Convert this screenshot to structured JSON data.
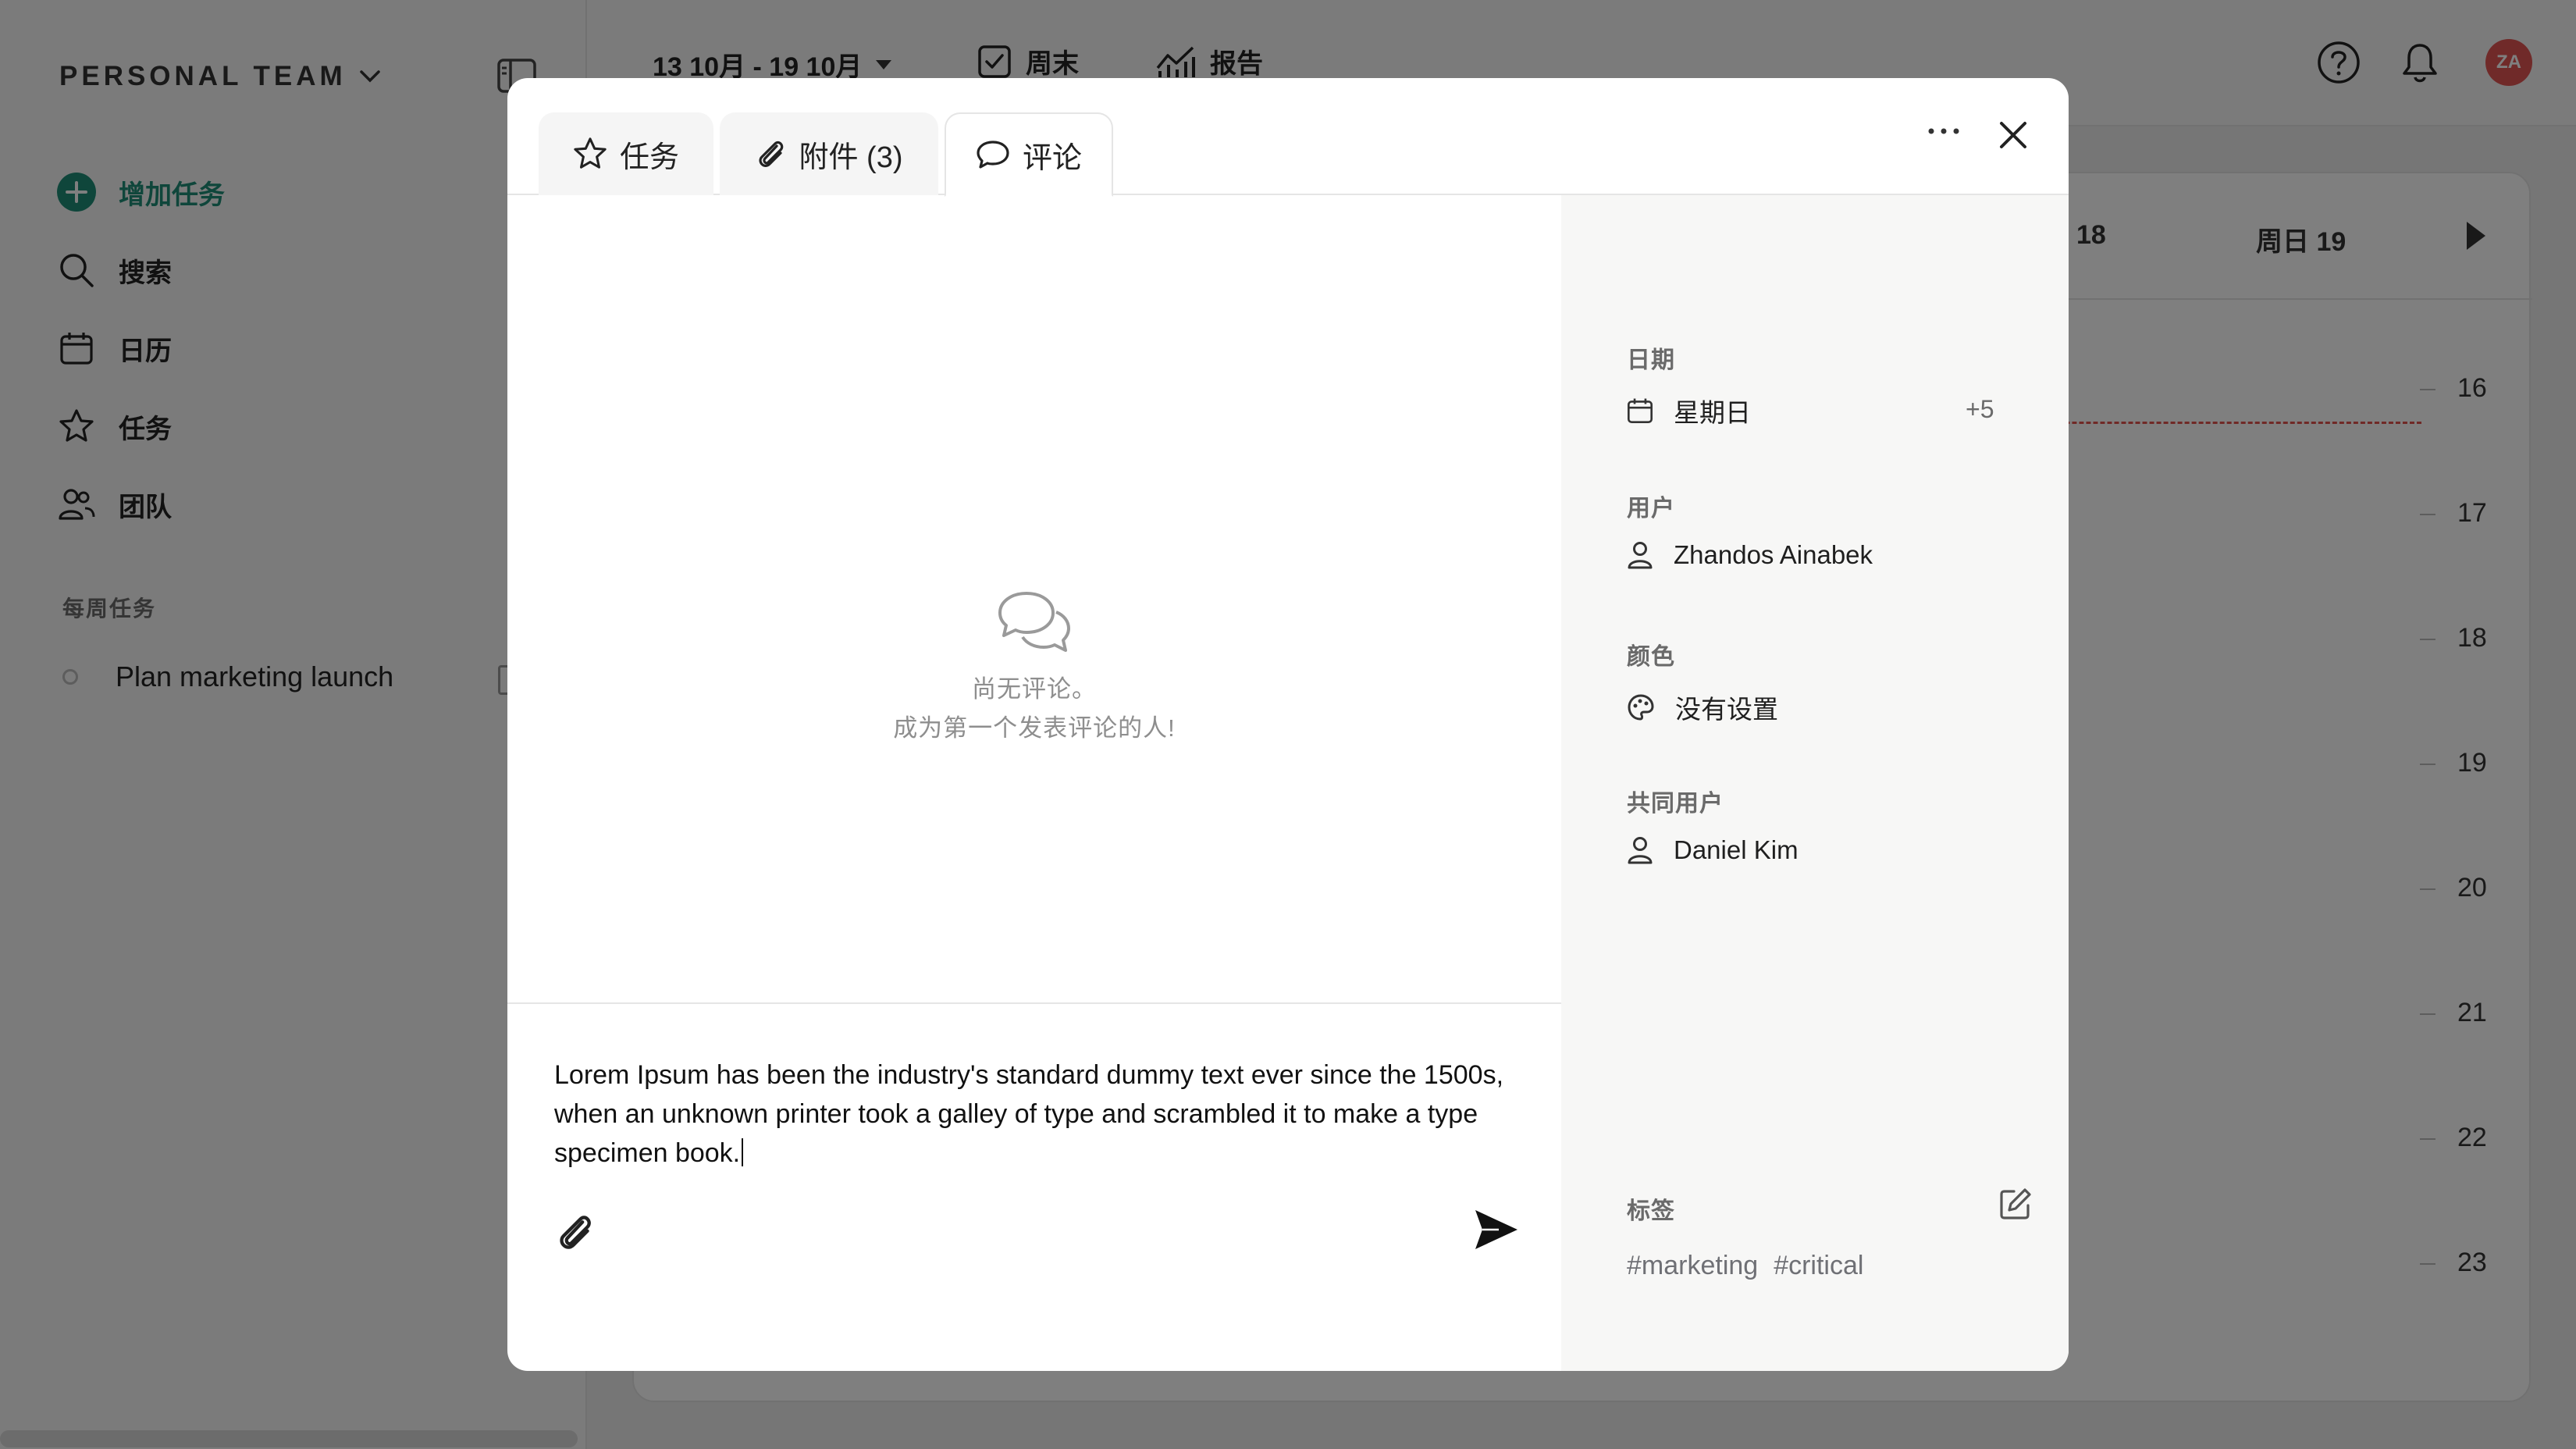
{
  "sidebar": {
    "team_name": "PERSONAL TEAM",
    "nav": [
      {
        "label": "增加任务",
        "icon": "plus-circle-icon"
      },
      {
        "label": "搜索",
        "icon": "search-icon"
      },
      {
        "label": "日历",
        "icon": "calendar-icon"
      },
      {
        "label": "任务",
        "icon": "star-icon"
      },
      {
        "label": "团队",
        "icon": "users-icon"
      }
    ],
    "section_title": "每周任务",
    "weekly_tasks": [
      {
        "label": "Plan marketing launch"
      }
    ]
  },
  "topbar": {
    "date_range": "13 10月 - 19 10月",
    "weekend_label": "周末",
    "report_label": "报告",
    "avatar_initials": "ZA"
  },
  "calendar": {
    "day_labels": [
      "18",
      "周日 19"
    ],
    "hours": [
      "16",
      "17",
      "18",
      "19",
      "20",
      "21",
      "22",
      "23"
    ]
  },
  "modal": {
    "tabs": [
      {
        "label": "任务",
        "icon": "star-icon"
      },
      {
        "label": "附件 (3)",
        "icon": "paperclip-icon"
      },
      {
        "label": "评论",
        "icon": "comment-icon"
      }
    ],
    "active_tab": "评论",
    "empty_state": {
      "line1": "尚无评论。",
      "line2": "成为第一个发表评论的人!"
    },
    "comment_draft": "Lorem Ipsum has been the industry's standard dummy text ever since the 1500s, when an unknown printer took a galley of type and scrambled it to make a type specimen book.",
    "details": {
      "date_label": "日期",
      "date_value": "星期日",
      "date_extra": "+5",
      "user_label": "用户",
      "user_value": "Zhandos Ainabek",
      "color_label": "颜色",
      "color_value": "没有设置",
      "co_users_label": "共同用户",
      "co_user_value": "Daniel Kim",
      "tags_label": "标签",
      "tags": [
        "#marketing",
        "#critical"
      ]
    }
  },
  "colors": {
    "accent": "#1e8c76",
    "avatar": "#e15552",
    "now_line": "#e0524d"
  }
}
